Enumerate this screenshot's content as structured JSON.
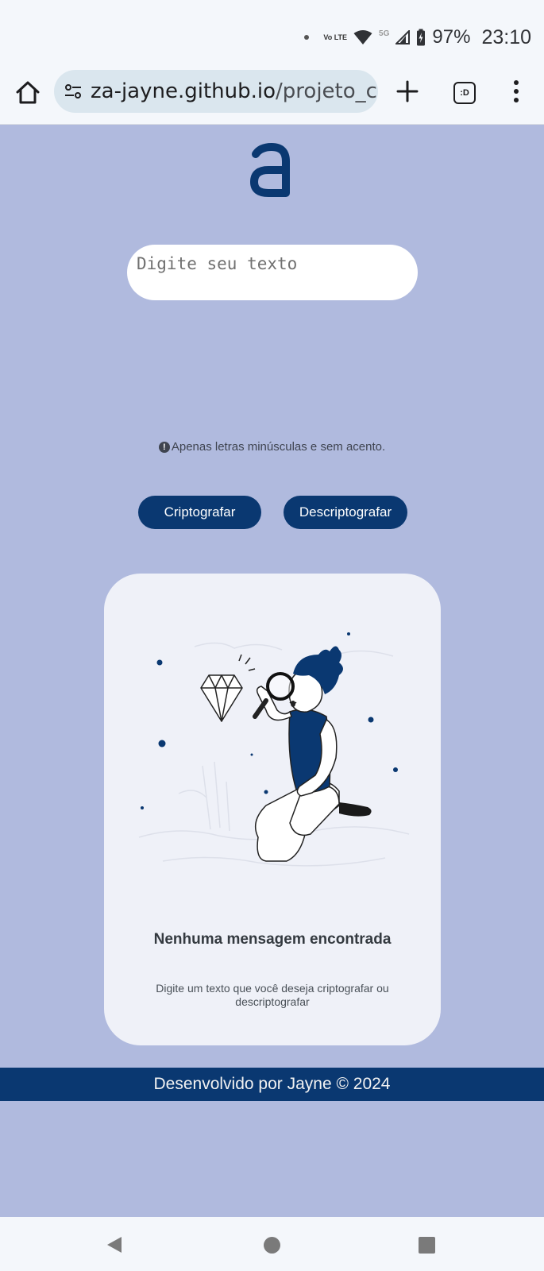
{
  "status_bar": {
    "volte_label": "Vo LTE",
    "network_label": "5G",
    "battery": "97%",
    "time": "23:10"
  },
  "browser": {
    "url_host": "za-jayne.github.io",
    "url_path": "/projeto_c",
    "tabs_label": ":D"
  },
  "app": {
    "logo_letter": "a",
    "input_placeholder": "Digite seu texto",
    "hint_icon": "!",
    "hint_text": "Apenas letras minúsculas e sem acento.",
    "encrypt_label": "Criptografar",
    "decrypt_label": "Descriptografar"
  },
  "output": {
    "title": "Nenhuma mensagem encontrada",
    "subtitle": "Digite um texto que você deseja criptografar ou descriptografar"
  },
  "footer": {
    "text": "Desenvolvido por Jayne © 2024"
  },
  "colors": {
    "page_background": "#b0bade",
    "accent": "#0a3871",
    "card_background": "#eff1f8"
  }
}
